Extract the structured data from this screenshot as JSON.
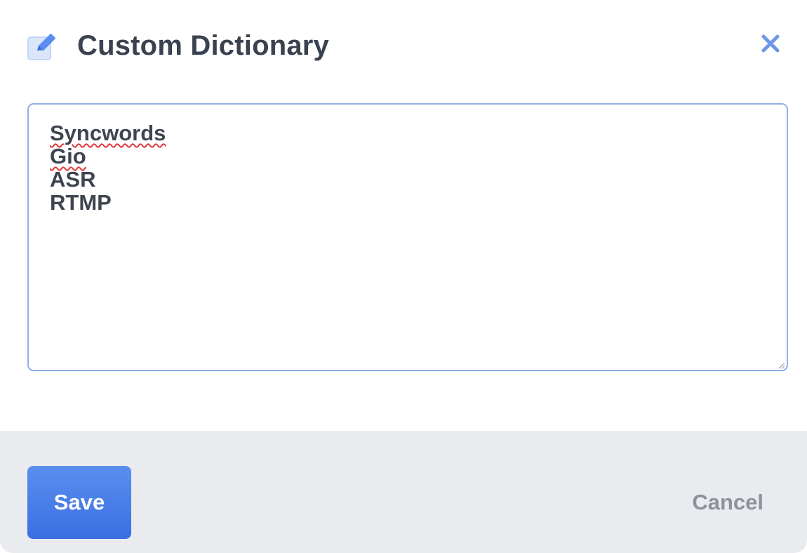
{
  "dialog": {
    "title": "Custom Dictionary",
    "title_icon": "edit-icon",
    "close_icon": "close-icon",
    "accent_color": "#3f76e4"
  },
  "dictionary": {
    "words": [
      "Syncwords",
      "Gio",
      "ASR",
      "RTMP"
    ],
    "misspelled": [
      "Syncwords",
      "Gio"
    ]
  },
  "footer": {
    "save_label": "Save",
    "cancel_label": "Cancel"
  }
}
